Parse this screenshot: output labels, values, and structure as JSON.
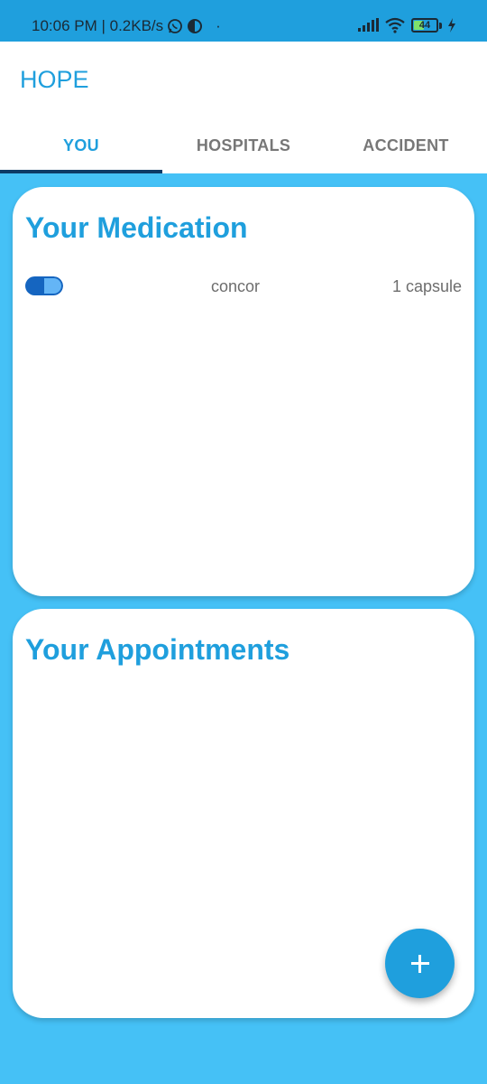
{
  "status_bar": {
    "time_speed": "10:06 PM | 0.2KB/s",
    "dot": "·",
    "battery": "44"
  },
  "app": {
    "title": "HOPE"
  },
  "tabs": [
    {
      "label": "YOU",
      "active": true
    },
    {
      "label": "HOSPITALS",
      "active": false
    },
    {
      "label": "ACCIDENT",
      "active": false
    }
  ],
  "medication": {
    "title": "Your Medication",
    "items": [
      {
        "name": "concor",
        "dose": "1 capsule",
        "icon": "capsule-icon"
      }
    ]
  },
  "appointments": {
    "title": "Your Appointments"
  },
  "fab": {
    "icon": "plus-icon"
  },
  "colors": {
    "primary": "#1f9fdd",
    "background": "#45c1f6",
    "tab_indicator": "#0d3a66"
  }
}
